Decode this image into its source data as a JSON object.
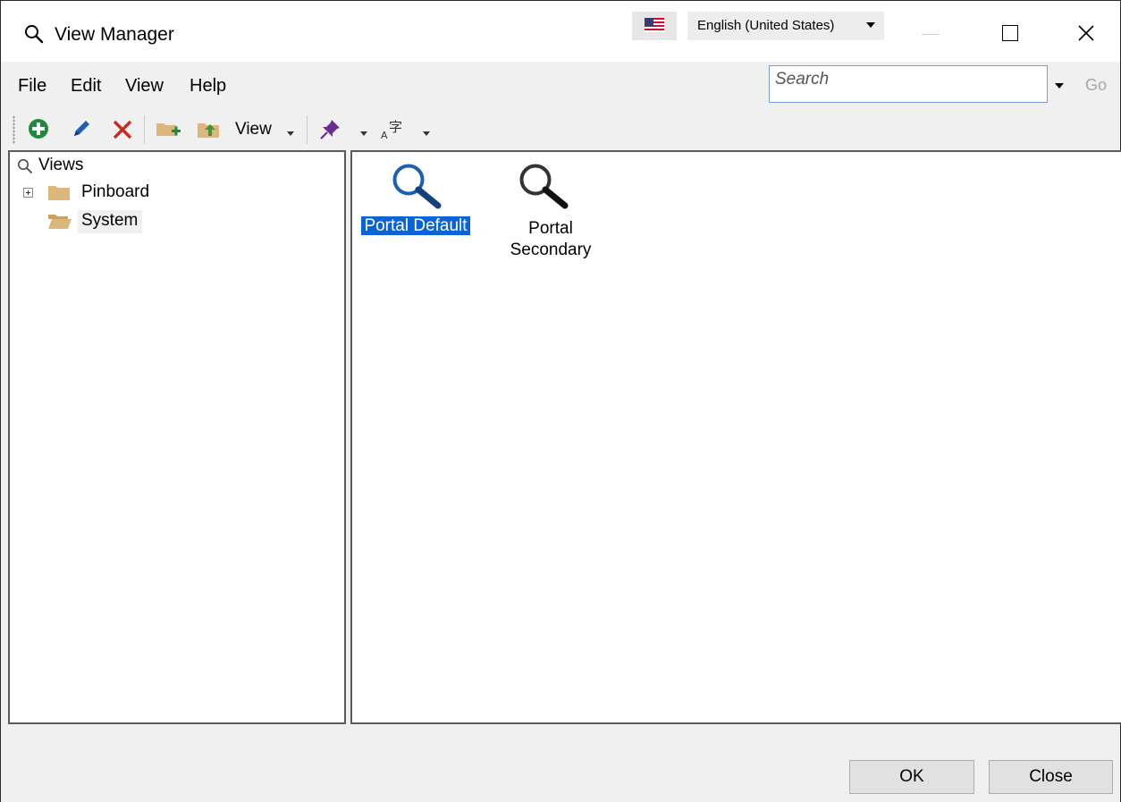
{
  "window": {
    "title": "View Manager",
    "language": "English (United States)",
    "icon": "magnifier-icon"
  },
  "menu": {
    "file": "File",
    "edit": "Edit",
    "view": "View",
    "help": "Help"
  },
  "search": {
    "placeholder": "Search",
    "go_label": "Go"
  },
  "toolbar": {
    "view_label": "View",
    "icons": [
      "add-icon",
      "edit-icon",
      "delete-icon",
      "new-folder-icon",
      "move-folder-icon",
      "pin-icon",
      "translate-icon"
    ]
  },
  "tree": {
    "root": "Views",
    "items": [
      {
        "label": "Pinboard",
        "expandable": true
      },
      {
        "label": "System",
        "expandable": false,
        "selected": true
      }
    ]
  },
  "items": [
    {
      "label": "Portal Default",
      "selected": true,
      "icon": "magnifier-blue-icon"
    },
    {
      "label_line1": "Portal",
      "label_line2": "Secondary",
      "selected": false,
      "icon": "magnifier-black-icon"
    }
  ],
  "footer": {
    "ok_label": "OK",
    "close_label": "Close"
  },
  "colors": {
    "selection": "#0a64d6",
    "folder": "#dcb67a",
    "add_green": "#1f8a3b",
    "delete_red": "#c42b1c",
    "pin_purple": "#6b2d8f"
  }
}
